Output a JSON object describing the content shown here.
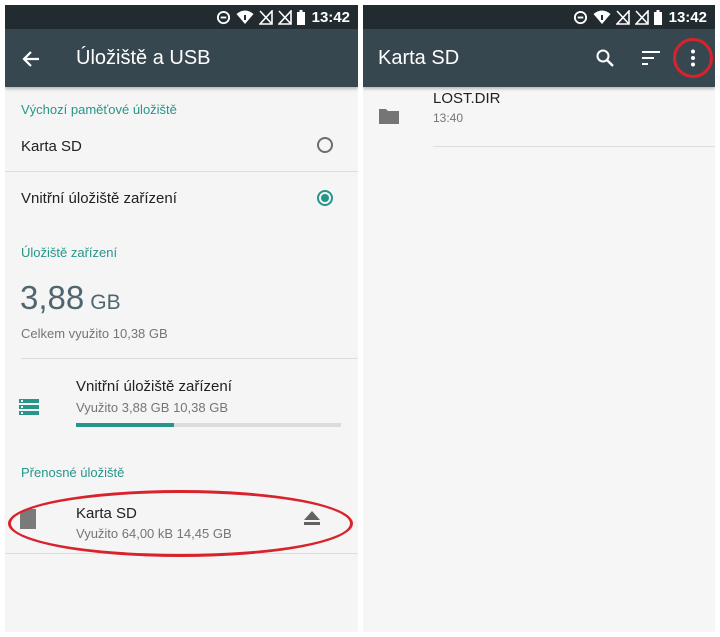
{
  "left": {
    "status_time": "13:42",
    "toolbar_title": "Úložiště a USB",
    "default_storage": {
      "header": "Výchozí paměťové úložiště",
      "options": [
        {
          "label": "Karta SD",
          "selected": false
        },
        {
          "label": "Vnitřní úložiště zařízení",
          "selected": true
        }
      ]
    },
    "device_storage": {
      "header": "Úložiště zařízení",
      "used_value": "3,88",
      "used_unit": "GB",
      "total_text": "Celkem využito 10,38 GB",
      "internal_item": {
        "title": "Vnitřní úložiště zařízení",
        "subtitle": "Využito 3,88 GB 10,38 GB",
        "usage_fraction": 0.37
      }
    },
    "portable_storage": {
      "header": "Přenosné úložiště",
      "sd_item": {
        "title": "Karta SD",
        "subtitle": "Využito 64,00 kB 14,45 GB"
      }
    }
  },
  "right": {
    "status_time": "13:42",
    "toolbar_title": "Karta SD",
    "files": [
      {
        "name": "LOST.DIR",
        "time": "13:40"
      }
    ]
  },
  "colors": {
    "accent": "#26958a",
    "toolbar": "#37474f",
    "statusbar": "#212b30",
    "highlight": "#d9232c"
  }
}
